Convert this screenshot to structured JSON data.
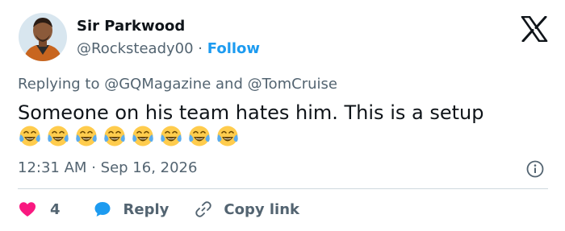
{
  "author": {
    "display_name": "Sir Parkwood",
    "handle": "@Rocksteady00",
    "separator": "·",
    "follow_label": "Follow"
  },
  "brand_icon": "x-logo-icon",
  "reply_context": {
    "prefix": "Replying to",
    "mention_1": "@GQMagazine",
    "conjunction": "and",
    "mention_2": "@TomCruise"
  },
  "tweet": {
    "text": "Someone on his team hates him. This is a setup",
    "emoji": "😂",
    "emoji_count": 8
  },
  "meta": {
    "time": "12:31 AM",
    "separator": "·",
    "date": "Sep 16, 2026"
  },
  "actions": {
    "like_count": "4",
    "reply_label": "Reply",
    "copy_link_label": "Copy link"
  },
  "colors": {
    "accent": "#1d9bf0",
    "like": "#f91880",
    "muted": "#536471",
    "text": "#0f1419"
  }
}
